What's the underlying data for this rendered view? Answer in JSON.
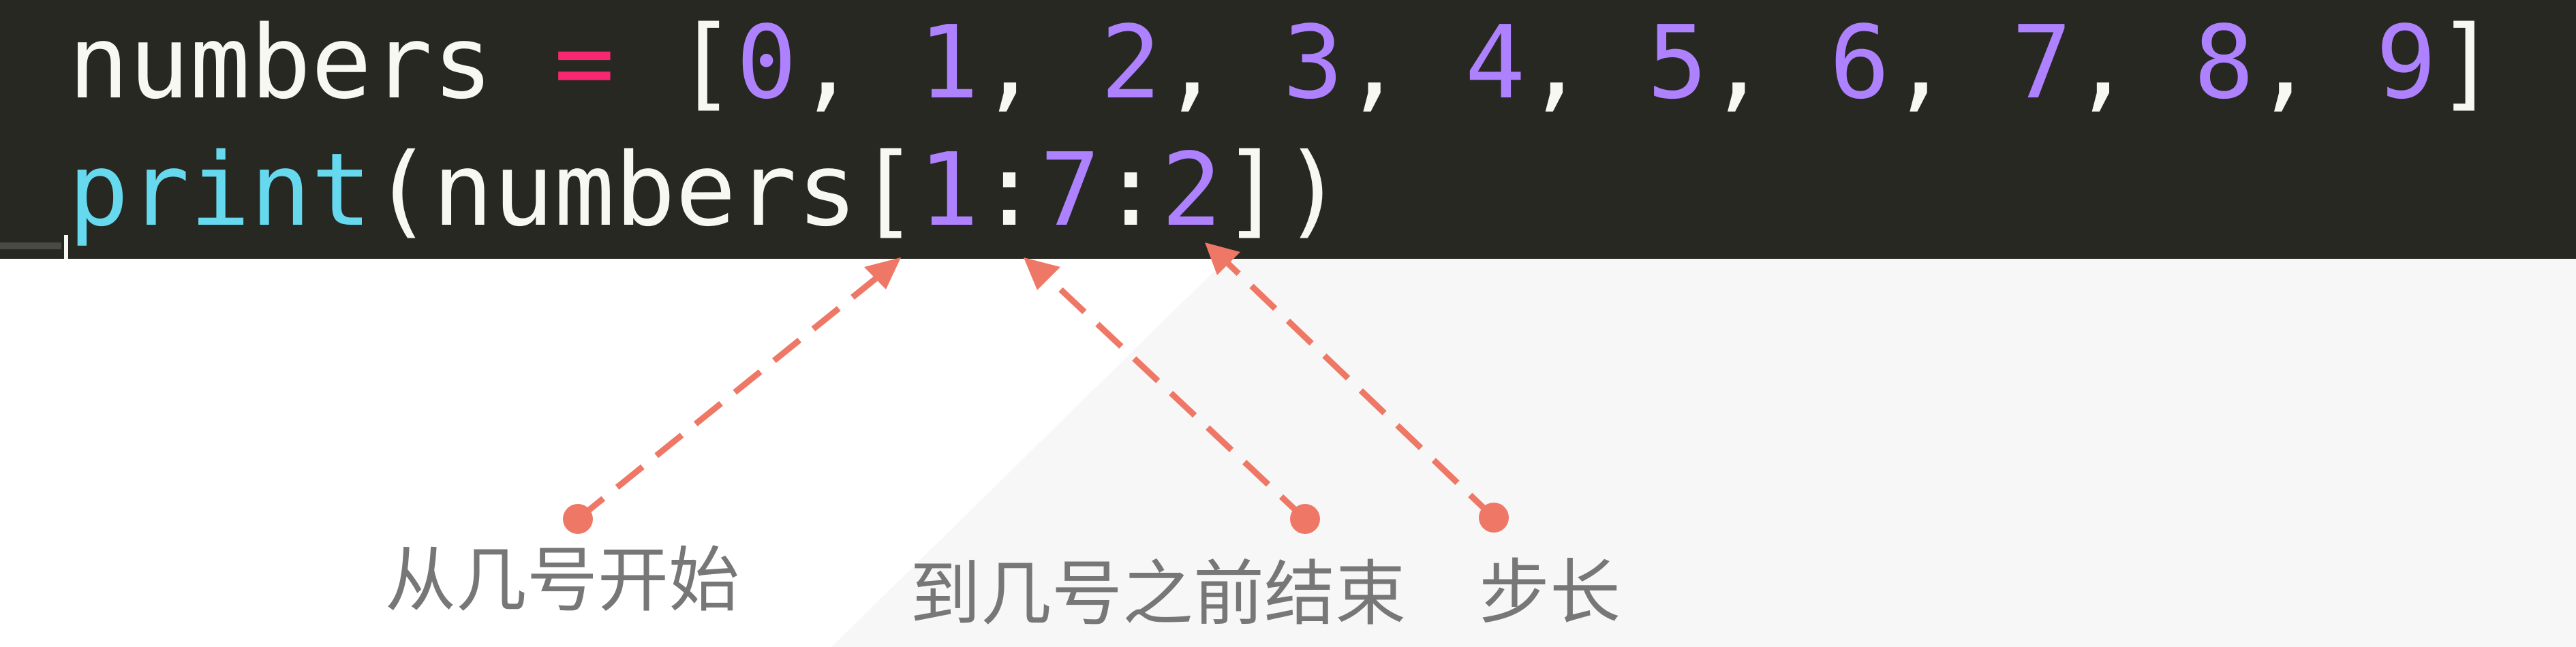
{
  "code": {
    "line1": {
      "var": "numbers ",
      "op": "=",
      "open": " [",
      "n0": "0",
      "sep0": ", ",
      "n1": "1",
      "sep1": ", ",
      "n2": "2",
      "sep2": ", ",
      "n3": "3",
      "sep3": ", ",
      "n4": "4",
      "sep4": ", ",
      "n5": "5",
      "sep5": ", ",
      "n6": "6",
      "sep6": ", ",
      "n7": "7",
      "sep7": ", ",
      "n8": "8",
      "sep8": ", ",
      "n9": "9",
      "close": "]"
    },
    "line2": {
      "func": "print",
      "open": "(numbers[",
      "start": "1",
      "colon1": ":",
      "stop": "7",
      "colon2": ":",
      "step": "2",
      "close": "])"
    }
  },
  "annotations": {
    "start_label": "从几号开始",
    "end_label": "到几号之前结束",
    "step_label": "步长",
    "arrow_color": "#ee7766"
  },
  "theme": {
    "editor_bg": "#272822",
    "number_color": "#ae81ff",
    "operator_color": "#f92672",
    "function_color": "#66d9ef",
    "text_color": "#f8f8f2",
    "label_color": "#777777"
  }
}
